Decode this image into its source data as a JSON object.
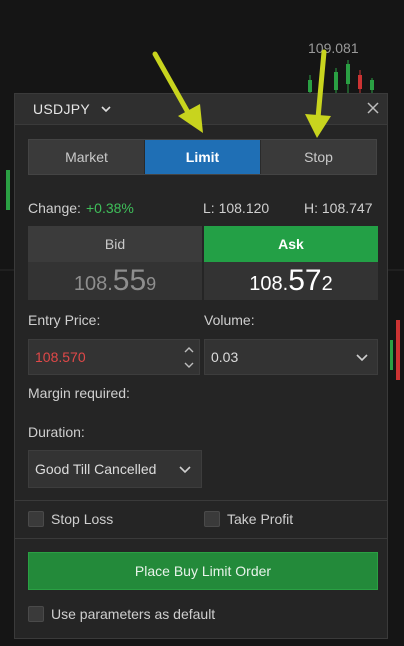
{
  "background": {
    "price_label": "109.081"
  },
  "dialog": {
    "symbol": "USDJPY",
    "tabs": [
      {
        "label": "Market",
        "active": false
      },
      {
        "label": "Limit",
        "active": true
      },
      {
        "label": "Stop",
        "active": false
      }
    ],
    "change_label": "Change:",
    "change_value": "+0.38%",
    "low": "L: 108.120",
    "high": "H: 108.747",
    "bid": {
      "label": "Bid",
      "price_prefix": "108.",
      "price_big": "55",
      "price_suffix": "9"
    },
    "ask": {
      "label": "Ask",
      "price_prefix": "108.",
      "price_big": "57",
      "price_suffix": "2"
    },
    "entry_price_label": "Entry Price:",
    "entry_price_value": "108.570",
    "volume_label": "Volume:",
    "volume_value": "0.03",
    "margin_label": "Margin required:",
    "duration_label": "Duration:",
    "duration_value": "Good Till Cancelled",
    "stop_loss_label": "Stop Loss",
    "take_profit_label": "Take Profit",
    "place_order_label": "Place Buy Limit Order",
    "default_params_label": "Use parameters as default"
  },
  "colors": {
    "accent_tab": "#1f6fb5",
    "ask_green": "#23a046",
    "change_green": "#3fbf5a",
    "entry_red": "#e04848",
    "annotation_arrow": "#c8d41e"
  }
}
